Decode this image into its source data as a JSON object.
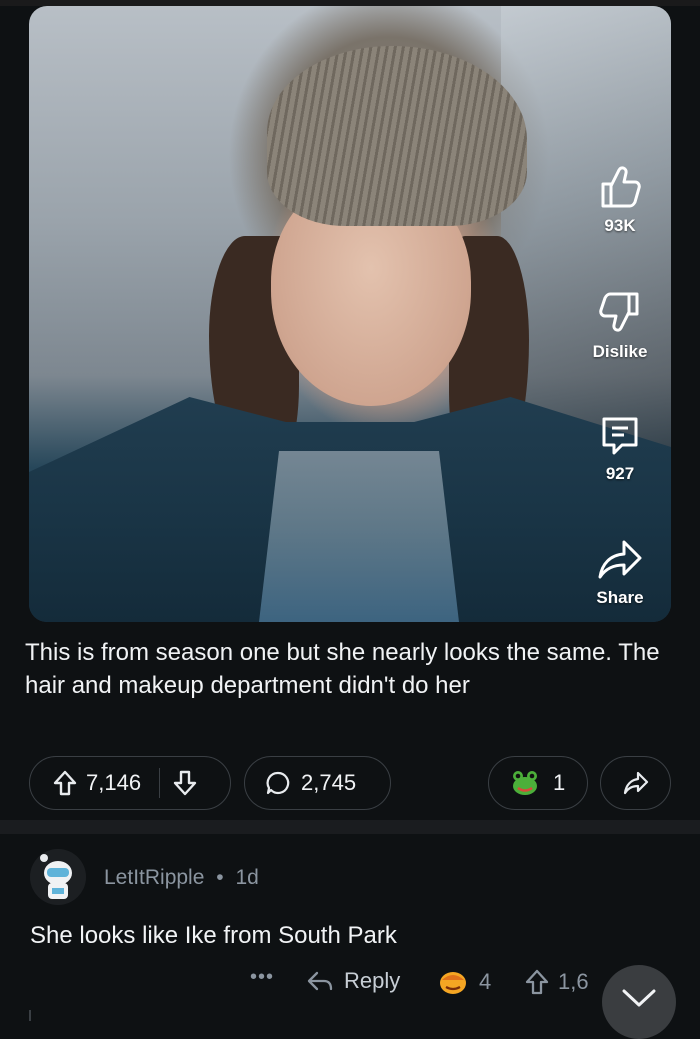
{
  "post": {
    "actions": {
      "like_count": "93K",
      "dislike_label": "Dislike",
      "comment_count": "927",
      "share_label": "Share"
    },
    "caption": "This is from season one but she nearly looks the same. The hair and makeup department didn't do her",
    "votes": "7,146",
    "comments": "2,745",
    "awards": "1"
  },
  "comment": {
    "username": "LetItRipple",
    "separator": "•",
    "age": "1d",
    "text": "She looks like Ike from South Park",
    "more_label": "•••",
    "reply_label": "Reply",
    "award_count": "4",
    "upvotes": "1,6"
  },
  "icons": {
    "like": "thumbs-up-icon",
    "dislike": "thumbs-down-icon",
    "comment": "comment-icon",
    "share": "share-arrow-icon",
    "upvote": "arrow-up-icon",
    "downvote": "arrow-down-icon",
    "award": "frog-award-icon",
    "reply": "reply-arrow-icon",
    "scroll": "chevron-down-icon"
  }
}
